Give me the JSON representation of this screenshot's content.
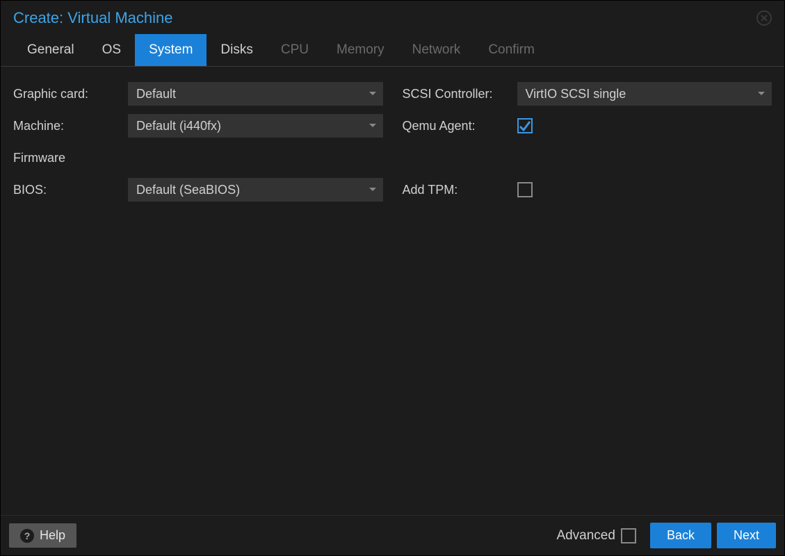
{
  "title": "Create: Virtual Machine",
  "tabs": [
    {
      "label": "General",
      "state": "enabled"
    },
    {
      "label": "OS",
      "state": "enabled"
    },
    {
      "label": "System",
      "state": "active"
    },
    {
      "label": "Disks",
      "state": "enabled"
    },
    {
      "label": "CPU",
      "state": "disabled"
    },
    {
      "label": "Memory",
      "state": "disabled"
    },
    {
      "label": "Network",
      "state": "disabled"
    },
    {
      "label": "Confirm",
      "state": "disabled"
    }
  ],
  "left": {
    "graphic_card": {
      "label": "Graphic card:",
      "value": "Default"
    },
    "machine": {
      "label": "Machine:",
      "value": "Default (i440fx)"
    },
    "firmware_header": "Firmware",
    "bios": {
      "label": "BIOS:",
      "value": "Default (SeaBIOS)"
    }
  },
  "right": {
    "scsi": {
      "label": "SCSI Controller:",
      "value": "VirtIO SCSI single"
    },
    "qemu_agent": {
      "label": "Qemu Agent:",
      "checked": true
    },
    "add_tpm": {
      "label": "Add TPM:",
      "checked": false
    }
  },
  "footer": {
    "help": "Help",
    "advanced": "Advanced",
    "advanced_checked": false,
    "back": "Back",
    "next": "Next"
  }
}
